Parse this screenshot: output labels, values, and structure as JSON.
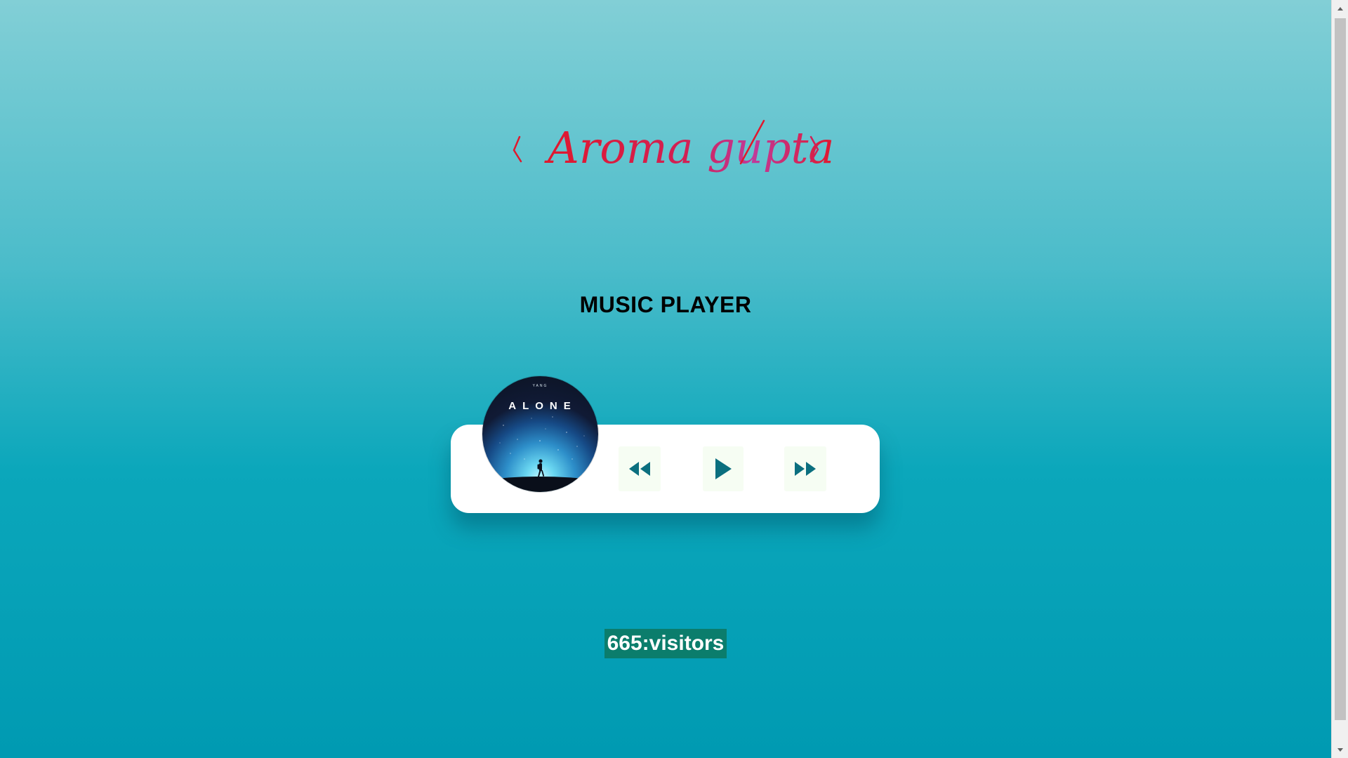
{
  "signature": {
    "text": "Aroma gupta"
  },
  "page": {
    "title": "MUSIC PLAYER"
  },
  "album": {
    "artist": "YANG",
    "title": "ALONE"
  },
  "controls": {
    "prev_icon": "rewind-icon",
    "play_icon": "play-icon",
    "next_icon": "fast-forward-icon"
  },
  "visitors": {
    "label": "665:visitors"
  },
  "colors": {
    "accent": "#0b6f7f",
    "signature_red": "#e0182d",
    "signature_pink": "#c03a9a",
    "counter_bg": "#0b7d6c",
    "button_bg": "#f6fdf3"
  }
}
